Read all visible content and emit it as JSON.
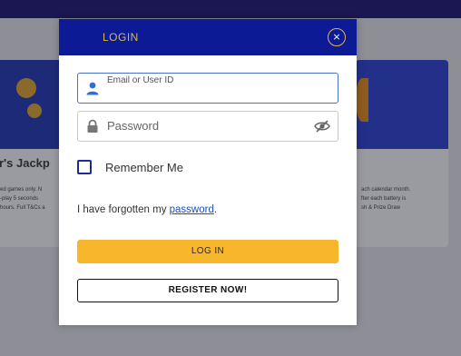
{
  "modal": {
    "title": "LOGIN",
    "close_glyph": "×",
    "email": {
      "label": "Email or User ID",
      "value": "",
      "icon": "user-icon"
    },
    "password": {
      "placeholder": "Password",
      "icon": "lock-icon",
      "toggle_icon": "eye-slash-icon"
    },
    "remember_label": "Remember Me",
    "forgot_prefix": "I have forgotten my ",
    "forgot_link": "password",
    "forgot_suffix": ".",
    "login_button": "LOG IN",
    "register_button": "REGISTER NOW!"
  },
  "background": {
    "left_card_title": "r's Jackp",
    "left_card_text": [
      "ed games only. N",
      "-play 5 seconds",
      "hours. Full T&Cs a"
    ],
    "right_card_text": [
      "ach calendar month.",
      "fter each battery is",
      "sh & Prize Draw"
    ]
  },
  "colors": {
    "header_bg": "#0c1a96",
    "title": "#d8b84a",
    "login_btn": "#f8b62d",
    "link": "#1d4fb8"
  }
}
